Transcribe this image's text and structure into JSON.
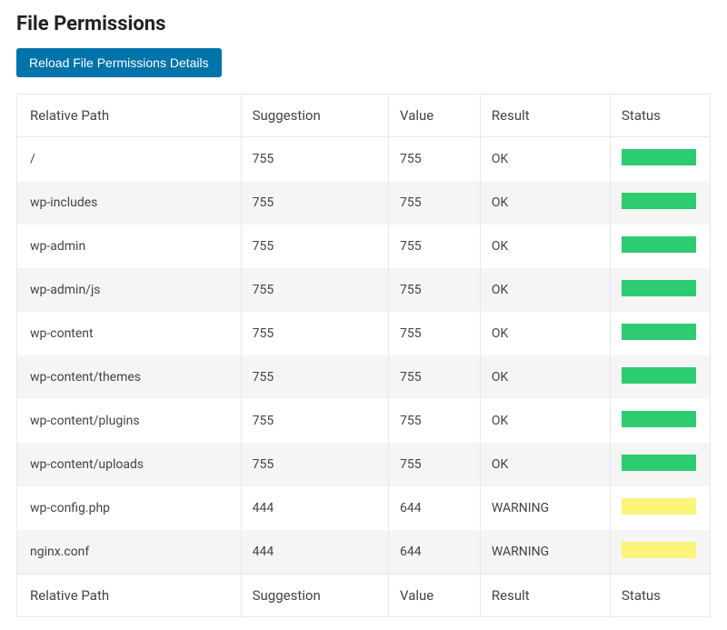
{
  "title": "File Permissions",
  "reload_label": "Reload File Permissions Details",
  "columns": {
    "path": "Relative Path",
    "suggestion": "Suggestion",
    "value": "Value",
    "result": "Result",
    "status": "Status"
  },
  "status_colors": {
    "ok": "#2ecc71",
    "warning": "#fcf37a"
  },
  "rows": [
    {
      "path": "/",
      "suggestion": "755",
      "value": "755",
      "result": "OK",
      "status": "ok"
    },
    {
      "path": "wp-includes",
      "suggestion": "755",
      "value": "755",
      "result": "OK",
      "status": "ok"
    },
    {
      "path": "wp-admin",
      "suggestion": "755",
      "value": "755",
      "result": "OK",
      "status": "ok"
    },
    {
      "path": "wp-admin/js",
      "suggestion": "755",
      "value": "755",
      "result": "OK",
      "status": "ok"
    },
    {
      "path": "wp-content",
      "suggestion": "755",
      "value": "755",
      "result": "OK",
      "status": "ok"
    },
    {
      "path": "wp-content/themes",
      "suggestion": "755",
      "value": "755",
      "result": "OK",
      "status": "ok"
    },
    {
      "path": "wp-content/plugins",
      "suggestion": "755",
      "value": "755",
      "result": "OK",
      "status": "ok"
    },
    {
      "path": "wp-content/uploads",
      "suggestion": "755",
      "value": "755",
      "result": "OK",
      "status": "ok"
    },
    {
      "path": "wp-config.php",
      "suggestion": "444",
      "value": "644",
      "result": "WARNING",
      "status": "warning"
    },
    {
      "path": "nginx.conf",
      "suggestion": "444",
      "value": "644",
      "result": "WARNING",
      "status": "warning"
    }
  ]
}
